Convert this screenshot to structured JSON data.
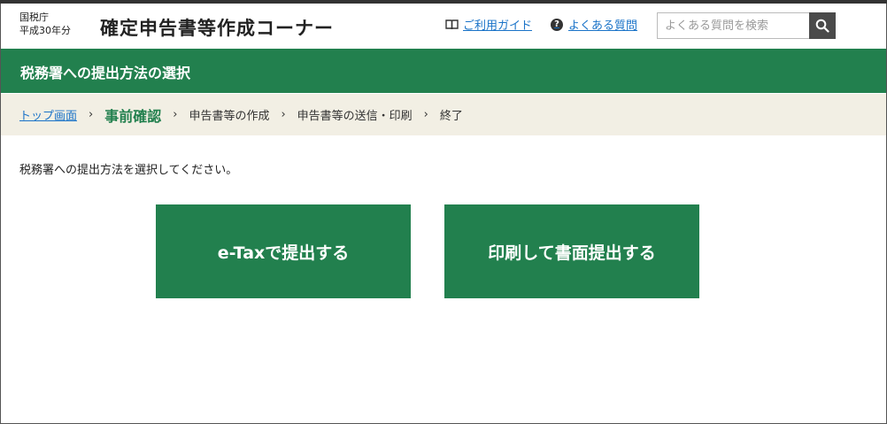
{
  "header": {
    "agency_line1": "国税庁",
    "agency_line2": "平成30年分",
    "site_title": "確定申告書等作成コーナー",
    "guide_link": "ご利用ガイド",
    "faq_link": "よくある質問",
    "search_placeholder": "よくある質問を検索"
  },
  "page": {
    "title": "税務署への提出方法の選択",
    "instruction": "税務署への提出方法を選択してください。"
  },
  "breadcrumb": {
    "items": [
      {
        "label": "トップ画面"
      },
      {
        "label": "事前確認"
      },
      {
        "label": "申告書等の作成"
      },
      {
        "label": "申告書等の送信・印刷"
      },
      {
        "label": "終了"
      }
    ],
    "separator": "›"
  },
  "options": {
    "etax_label": "e-Taxで提出する",
    "print_label": "印刷して書面提出する"
  },
  "colors": {
    "brand_green": "#22804e",
    "breadcrumb_bg": "#f2efe4",
    "link_blue": "#1a73c8"
  }
}
